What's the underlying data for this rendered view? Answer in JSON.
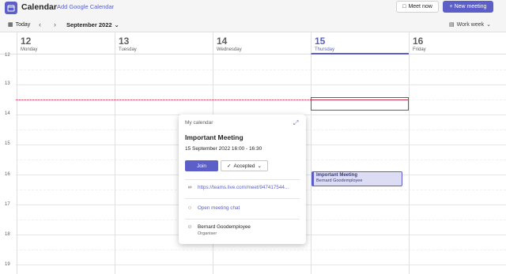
{
  "app": {
    "title": "Calendar",
    "add_google": "Add Google Calendar",
    "meet_now": "Meet now",
    "new_meeting": "+ New meeting"
  },
  "nav": {
    "today": "Today",
    "month": "September 2022",
    "view": "Work week"
  },
  "days": [
    {
      "num": "12",
      "name": "Monday"
    },
    {
      "num": "13",
      "name": "Tuesday"
    },
    {
      "num": "14",
      "name": "Wednesday"
    },
    {
      "num": "15",
      "name": "Thursday",
      "is_today": true
    },
    {
      "num": "16",
      "name": "Friday"
    }
  ],
  "hours": [
    "12",
    "13",
    "14",
    "15",
    "16",
    "17",
    "18",
    "19"
  ],
  "event": {
    "title": "Important Meeting",
    "organizer": "Bernard Goodemployee"
  },
  "popup": {
    "calendar": "My calendar",
    "title": "Important Meeting",
    "time": "15 September 2022 16:00 - 16:30",
    "join": "Join",
    "accepted": "Accepted",
    "link": "https://teams.live.com/meet/947417544...",
    "chat": "Open meeting chat",
    "organizer": "Bernard Goodemployee",
    "organizer_role": "Organiser"
  },
  "colors": {
    "accent": "#5b5fc7",
    "now_line": "#c4314b"
  }
}
